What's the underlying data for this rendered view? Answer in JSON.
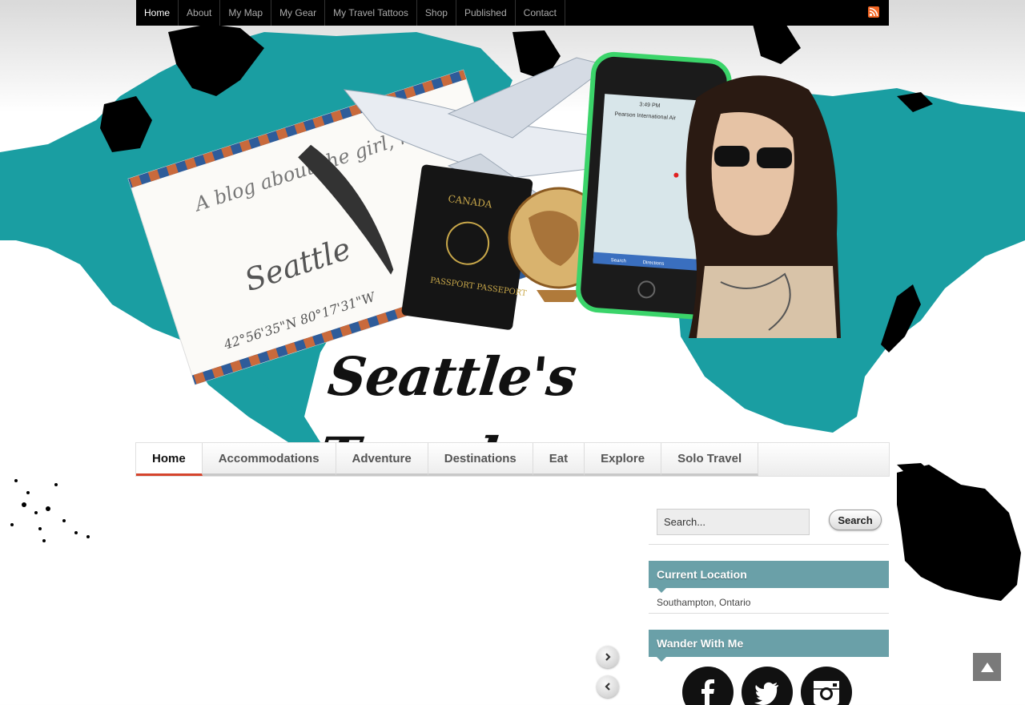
{
  "top_nav": {
    "items": [
      "Home",
      "About",
      "My Map",
      "My Gear",
      "My Travel Tattoos",
      "Shop",
      "Published",
      "Contact"
    ],
    "active": "Home"
  },
  "header": {
    "site_title": "Seattle's Travels",
    "postcard_text": "A blog about the girl, not the city",
    "signature": "Seattle",
    "coords": "42°56'35\"N 80°17'31\"W",
    "passport_country": "CANADA",
    "passport_label": "PASSPORT PASSEPORT",
    "phone_location": "Pearson International Air",
    "phone_time": "3:49 PM",
    "phone_search": "Search",
    "phone_directions": "Directions"
  },
  "cat_nav": {
    "items": [
      "Home",
      "Accommodations",
      "Adventure",
      "Destinations",
      "Eat",
      "Explore",
      "Solo Travel"
    ],
    "active": "Home"
  },
  "sidebar": {
    "search_placeholder": "Search...",
    "search_button": "Search",
    "current_location_title": "Current Location",
    "current_location": "Southampton, Ontario",
    "wander_title": "Wander With Me",
    "social": [
      "facebook-icon",
      "twitter-icon",
      "instagram-icon"
    ]
  },
  "colors": {
    "teal": "#1a9ea2",
    "widget_title": "#6aa0a8",
    "active_tab": "#d5442d"
  }
}
